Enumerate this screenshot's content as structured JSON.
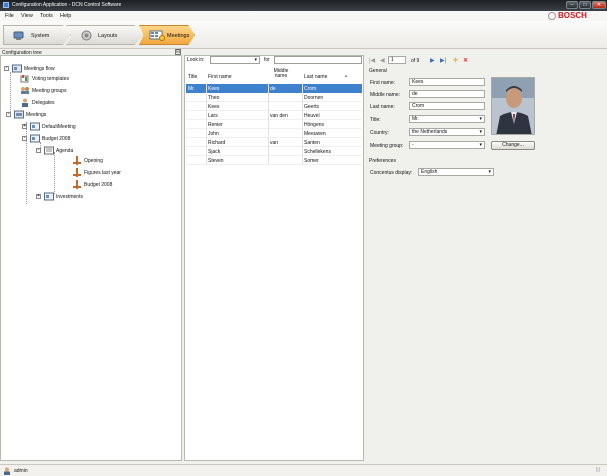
{
  "window": {
    "title": "Configuration Application - DCN Control Software",
    "minimize": "–",
    "maximize": "□",
    "close": "✕"
  },
  "menu": [
    "File",
    "View",
    "Tools",
    "Help"
  ],
  "brand": {
    "name": "BOSCH"
  },
  "nav": {
    "buttons": [
      {
        "label": "System",
        "icon": "system-icon"
      },
      {
        "label": "Layouts",
        "icon": "layouts-icon"
      },
      {
        "label": "Meetings",
        "icon": "meetings-icon",
        "active": true
      }
    ]
  },
  "tree": {
    "header": "Configuration tree",
    "collapse_glyph": "⊟",
    "nodes": [
      {
        "label": "Meetings flow",
        "level": 0,
        "expander": "-"
      },
      {
        "label": "Voting templates",
        "level": 1
      },
      {
        "label": "Meeting groups",
        "level": 1
      },
      {
        "label": "Delegates",
        "level": 1
      },
      {
        "label": "Meetings",
        "level": 1,
        "expander": "-"
      },
      {
        "label": "DefaultMeeting",
        "level": 2,
        "expander": "+"
      },
      {
        "label": "Budget 2008",
        "level": 2,
        "expander": "-"
      },
      {
        "label": "Agenda",
        "level": 3,
        "expander": "-"
      },
      {
        "label": "Opening",
        "level": 4
      },
      {
        "label": "Figures last year",
        "level": 4
      },
      {
        "label": "Budget 2008",
        "level": 4
      },
      {
        "label": "Investments",
        "level": 2,
        "expander": "+"
      }
    ]
  },
  "search": {
    "look_in_label": "Look in:",
    "look_in_value": "",
    "for_label": "for",
    "for_value": ""
  },
  "table": {
    "columns": [
      "Title",
      "First name",
      "Middle name",
      "Last name"
    ],
    "sort_glyph": "▲",
    "rows": [
      {
        "title": "Mr.",
        "first": "Kees",
        "middle": "de",
        "last": "Crom",
        "selected": true
      },
      {
        "title": "",
        "first": "Theo",
        "middle": "",
        "last": "Doornen"
      },
      {
        "title": "",
        "first": "Kees",
        "middle": "",
        "last": "Geerts"
      },
      {
        "title": "",
        "first": "Lars",
        "middle": "van den",
        "last": "Heuvel"
      },
      {
        "title": "",
        "first": "Renier",
        "middle": "",
        "last": "Höngens"
      },
      {
        "title": "",
        "first": "John",
        "middle": "",
        "last": "Meeuwen"
      },
      {
        "title": "",
        "first": "Richard",
        "middle": "van",
        "last": "Santen"
      },
      {
        "title": "",
        "first": "Sjack",
        "middle": "",
        "last": "Schellekens"
      },
      {
        "title": "",
        "first": "Steven",
        "middle": "",
        "last": "Somer"
      }
    ]
  },
  "record_nav": {
    "first": "|◀",
    "prev": "◀",
    "current": "1",
    "of_text": "of 9",
    "next": "▶",
    "last": "▶|",
    "add": "✚",
    "delete": "✕"
  },
  "general": {
    "heading": "General",
    "first_name_label": "First name:",
    "first_name": "Kees",
    "middle_name_label": "Middle name:",
    "middle_name": "de",
    "last_name_label": "Last name:",
    "last_name": "Crom",
    "title_label": "Title:",
    "title_value": "Mr.",
    "country_label": "Country:",
    "country_value": "the Netherlands",
    "meeting_group_label": "Meeting group:",
    "meeting_group_value": "-",
    "change_button": "Change..."
  },
  "preferences": {
    "heading": "Preferences",
    "concentus_label": "Concentus display:",
    "concentus_value": "English"
  },
  "status": {
    "user": "admin",
    "grip": "|||"
  },
  "colors": {
    "selection": "#3e82ce",
    "active_nav": "#f1a73e",
    "brand": "#d71920",
    "delete": "#d7372a",
    "add": "#f0b323"
  }
}
